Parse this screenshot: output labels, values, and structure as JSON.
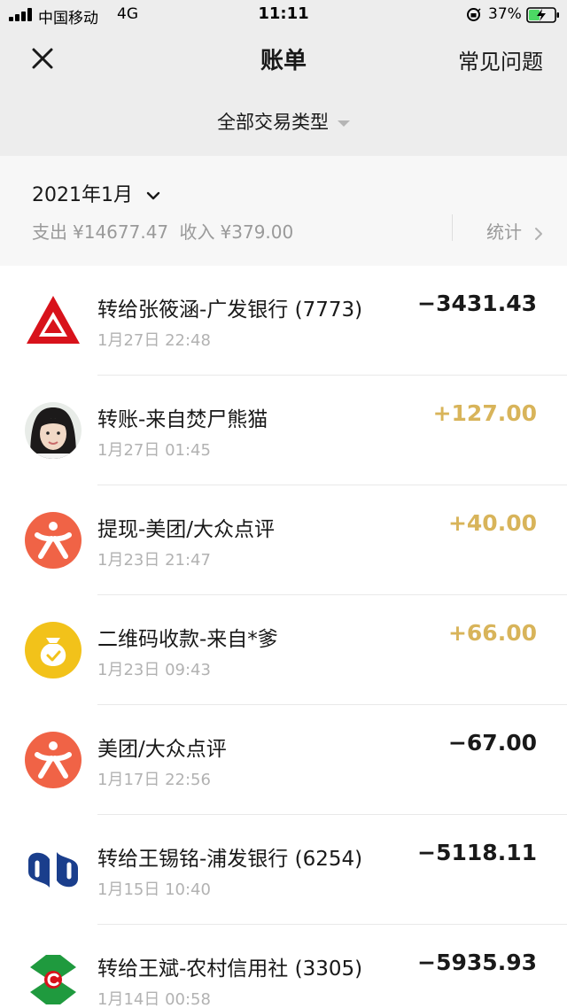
{
  "status_bar": {
    "carrier": "中国移动",
    "network": "4G",
    "time": "11:11",
    "battery": "37%"
  },
  "nav": {
    "title": "账单",
    "faq": "常见问题"
  },
  "filter": {
    "label": "全部交易类型"
  },
  "month": {
    "label": "2021年1月",
    "expense_label": "支出",
    "expense": "¥14677.47",
    "income_label": "收入",
    "income": "¥379.00",
    "stats": "统计"
  },
  "colors": {
    "income_amount": "#d8b45a",
    "expense_amount": "#191919",
    "header_bg": "#ededed"
  },
  "transactions": [
    {
      "title": "转给张筱涵-广发银行 (7773)",
      "time": "1月27日 22:48",
      "amount": "−3431.43",
      "direction": "out",
      "icon": "cgb-bank-icon"
    },
    {
      "title": "转账-来自焚尸熊猫",
      "time": "1月27日 01:45",
      "amount": "+127.00",
      "direction": "in",
      "icon": "user-avatar"
    },
    {
      "title": "提现-美团/大众点评",
      "time": "1月23日 21:47",
      "amount": "+40.00",
      "direction": "in",
      "icon": "meituan-dianping-icon"
    },
    {
      "title": "二维码收款-来自*爹",
      "time": "1月23日 09:43",
      "amount": "+66.00",
      "direction": "in",
      "icon": "qr-payment-money-bag-icon"
    },
    {
      "title": "美团/大众点评",
      "time": "1月17日 22:56",
      "amount": "−67.00",
      "direction": "out",
      "icon": "meituan-dianping-icon"
    },
    {
      "title": "转给王锡铭-浦发银行 (6254)",
      "time": "1月15日 10:40",
      "amount": "−5118.11",
      "direction": "out",
      "icon": "spdb-bank-icon"
    },
    {
      "title": "转给王斌-农村信用社 (3305)",
      "time": "1月14日 00:58",
      "amount": "−5935.93",
      "direction": "out",
      "icon": "rural-credit-union-icon"
    }
  ]
}
